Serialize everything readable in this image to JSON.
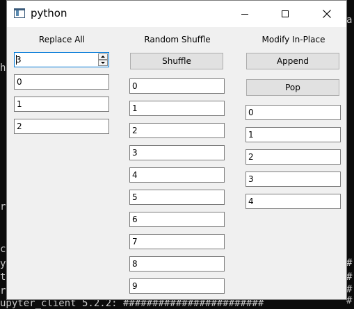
{
  "terminal": {
    "left_fragments": [
      "h",
      "r",
      "c",
      "y",
      "t",
      "r"
    ],
    "bottom_line": "upyter_client 5.2.2: ########################",
    "right_fragments": [
      "a",
      "#",
      "#",
      "#",
      "#"
    ]
  },
  "window": {
    "title": "python"
  },
  "replace_all": {
    "heading": "Replace All",
    "spin_value": "3",
    "items": [
      "0",
      "1",
      "2"
    ]
  },
  "random_shuffle": {
    "heading": "Random Shuffle",
    "button_label": "Shuffle",
    "items": [
      "0",
      "1",
      "2",
      "3",
      "4",
      "5",
      "6",
      "7",
      "8",
      "9"
    ]
  },
  "modify_in_place": {
    "heading": "Modify In-Place",
    "append_label": "Append",
    "pop_label": "Pop",
    "items": [
      "0",
      "1",
      "2",
      "3",
      "4"
    ]
  }
}
